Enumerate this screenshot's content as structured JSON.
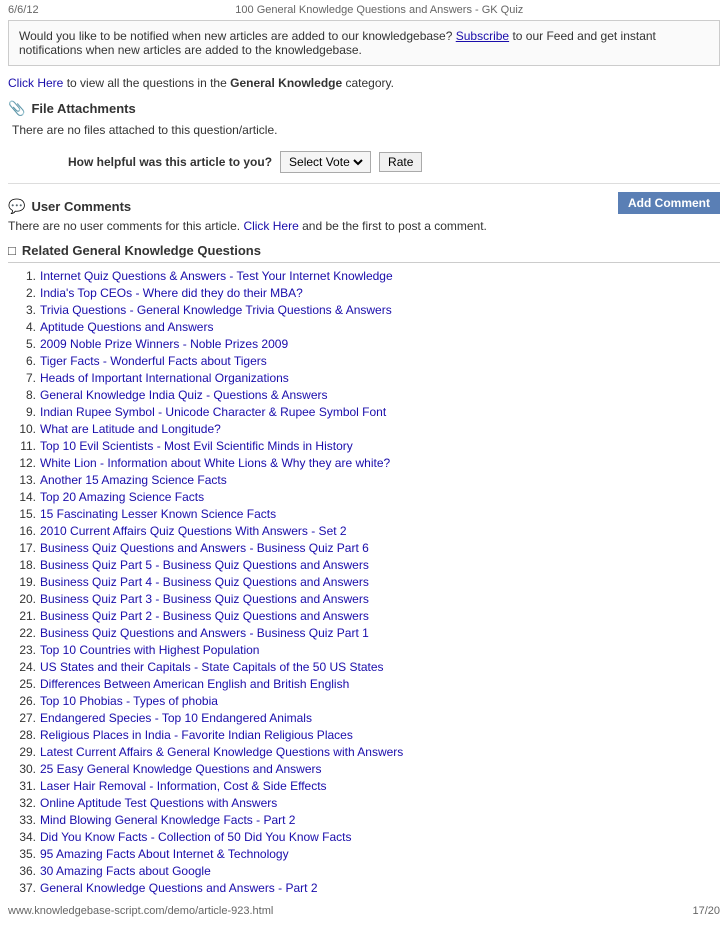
{
  "topBar": {
    "date": "6/6/12",
    "title": "100 General Knowledge Questions and Answers - GK Quiz"
  },
  "notification": {
    "text1": "Would you like to be notified when new articles are added to our knowledgebase?",
    "linkText": "Subscribe",
    "text2": "to our Feed and get instant notifications when new articles are added to the knowledgebase."
  },
  "clickHereLine": {
    "prefix": "",
    "linkText": "Click Here",
    "middle": " to view all the questions in the ",
    "bold": "General Knowledge",
    "suffix": " category."
  },
  "fileAttachments": {
    "sectionTitle": "File Attachments",
    "noFilesText": "There are no files attached to this question/article."
  },
  "helpful": {
    "label": "How helpful was this article to you?",
    "selectPlaceholder": "Select Vote",
    "rateLabel": "Rate"
  },
  "userComments": {
    "sectionTitle": "User Comments",
    "addCommentLabel": "Add Comment",
    "text1": "There are no user comments for this article.",
    "linkText": "Click Here",
    "text2": " and be the first to post a comment."
  },
  "related": {
    "sectionTitle": "Related General Knowledge Questions",
    "items": [
      {
        "num": "1.",
        "text": "Internet Quiz Questions & Answers - Test Your Internet Knowledge"
      },
      {
        "num": "2.",
        "text": "India's Top CEOs - Where did they do their MBA?"
      },
      {
        "num": "3.",
        "text": "Trivia Questions - General Knowledge Trivia Questions & Answers"
      },
      {
        "num": "4.",
        "text": "Aptitude Questions and Answers"
      },
      {
        "num": "5.",
        "text": "2009 Noble Prize Winners - Noble Prizes 2009"
      },
      {
        "num": "6.",
        "text": "Tiger Facts - Wonderful Facts about Tigers"
      },
      {
        "num": "7.",
        "text": "Heads of Important International Organizations"
      },
      {
        "num": "8.",
        "text": "General Knowledge India Quiz - Questions & Answers"
      },
      {
        "num": "9.",
        "text": "Indian Rupee Symbol - Unicode Character & Rupee Symbol Font"
      },
      {
        "num": "10.",
        "text": "What are Latitude and Longitude?"
      },
      {
        "num": "11.",
        "text": "Top 10 Evil Scientists - Most Evil Scientific Minds in History"
      },
      {
        "num": "12.",
        "text": "White Lion - Information about White Lions & Why they are white?"
      },
      {
        "num": "13.",
        "text": "Another 15 Amazing Science Facts"
      },
      {
        "num": "14.",
        "text": "Top 20 Amazing Science Facts"
      },
      {
        "num": "15.",
        "text": "15 Fascinating Lesser Known Science Facts"
      },
      {
        "num": "16.",
        "text": "2010 Current Affairs Quiz Questions With Answers - Set 2"
      },
      {
        "num": "17.",
        "text": "Business Quiz Questions and Answers - Business Quiz Part 6"
      },
      {
        "num": "18.",
        "text": "Business Quiz Part 5 - Business Quiz Questions and Answers"
      },
      {
        "num": "19.",
        "text": "Business Quiz Part 4 - Business Quiz Questions and Answers"
      },
      {
        "num": "20.",
        "text": "Business Quiz Part 3 - Business Quiz Questions and Answers"
      },
      {
        "num": "21.",
        "text": "Business Quiz Part 2 - Business Quiz Questions and Answers"
      },
      {
        "num": "22.",
        "text": "Business Quiz Questions and Answers - Business Quiz Part 1"
      },
      {
        "num": "23.",
        "text": "Top 10 Countries with Highest Population"
      },
      {
        "num": "24.",
        "text": "US States and their Capitals - State Capitals of the 50 US States"
      },
      {
        "num": "25.",
        "text": "Differences Between American English and British English"
      },
      {
        "num": "26.",
        "text": "Top 10 Phobias - Types of phobia"
      },
      {
        "num": "27.",
        "text": "Endangered Species - Top 10 Endangered Animals"
      },
      {
        "num": "28.",
        "text": "Religious Places in India - Favorite Indian Religious Places"
      },
      {
        "num": "29.",
        "text": "Latest Current Affairs & General Knowledge Questions with Answers"
      },
      {
        "num": "30.",
        "text": "25 Easy General Knowledge Questions and Answers"
      },
      {
        "num": "31.",
        "text": "Laser Hair Removal - Information, Cost & Side Effects"
      },
      {
        "num": "32.",
        "text": "Online Aptitude Test Questions with Answers"
      },
      {
        "num": "33.",
        "text": "Mind Blowing General Knowledge Facts - Part 2"
      },
      {
        "num": "34.",
        "text": "Did You Know Facts - Collection of 50 Did You Know Facts"
      },
      {
        "num": "35.",
        "text": "95 Amazing Facts About Internet & Technology"
      },
      {
        "num": "36.",
        "text": "30 Amazing Facts about Google"
      },
      {
        "num": "37.",
        "text": "General Knowledge Questions and Answers - Part 2"
      }
    ]
  },
  "bottomBar": {
    "url": "www.knowledgebase-script.com/demo/article-923.html",
    "pagination": "17/20"
  }
}
